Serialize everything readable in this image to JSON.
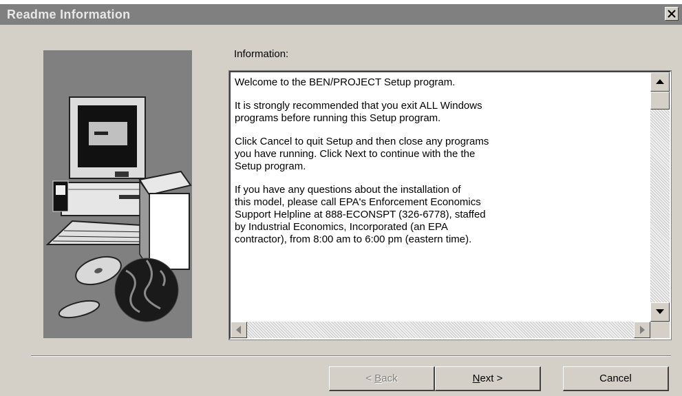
{
  "window": {
    "title": "Readme Information"
  },
  "content": {
    "info_label": "Information:",
    "paragraphs": [
      "Welcome to the BEN/PROJECT Setup program.",
      "It is strongly recommended that you exit ALL Windows\nprograms before running this Setup program.",
      "Click Cancel to quit Setup and then close any programs\nyou have running. Click Next to continue with the the\nSetup program.",
      "If you have any questions about the installation of\nthis model, please call EPA's Enforcement Economics\nSupport Helpline at 888-ECONSPT (326-6778), staffed\nby Industrial Economics, Incorporated (an EPA\ncontractor), from 8:00 am to 6:00 pm (eastern time)."
    ]
  },
  "buttons": {
    "back": {
      "prefix": "< ",
      "accel": "B",
      "rest": "ack",
      "enabled": false
    },
    "next": {
      "accel": "N",
      "rest": "ext >",
      "enabled": true
    },
    "cancel": {
      "label": "Cancel",
      "enabled": true
    }
  },
  "icons": [
    "close-icon",
    "computer-illustration",
    "scroll-up-icon",
    "scroll-down-icon",
    "scroll-left-icon",
    "scroll-right-icon"
  ],
  "colors": {
    "title_bar": "#808080",
    "dialog_face": "#d4d0c8",
    "art_background": "#808080"
  }
}
